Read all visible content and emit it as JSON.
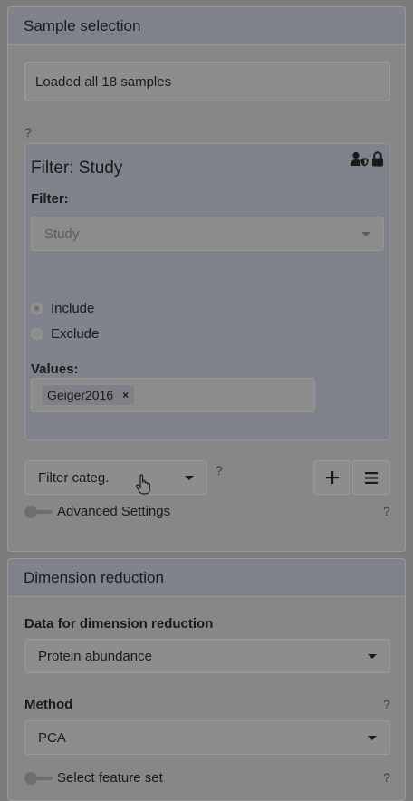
{
  "sample_selection": {
    "title": "Sample selection",
    "status": "Loaded all 18 samples",
    "help": "?",
    "filter_card": {
      "title": "Filter: Study",
      "icons": [
        "user-shield-icon",
        "lock-icon"
      ],
      "filter_label": "Filter:",
      "filter_value": "Study",
      "include_label": "Include",
      "exclude_label": "Exclude",
      "values_label": "Values:",
      "value_chip": "Geiger2016",
      "chip_remove": "×"
    },
    "category_select": {
      "value": "Filter categ."
    },
    "category_help": "?",
    "add_button_icon": "plus-icon",
    "menu_button_icon": "bars-icon",
    "advanced_toggle_label": "Advanced Settings",
    "advanced_help": "?"
  },
  "dimension_reduction": {
    "title": "Dimension reduction",
    "data_label": "Data for dimension reduction",
    "data_value": "Protein abundance",
    "method_label": "Method",
    "method_help": "?",
    "method_value": "PCA",
    "feature_toggle_label": "Select feature set",
    "feature_help": "?"
  },
  "colors": {
    "overlay_background": "#7b7b7b",
    "panel": "#878787",
    "panel_header": "#81838c",
    "help_link": "#2b3d55"
  }
}
